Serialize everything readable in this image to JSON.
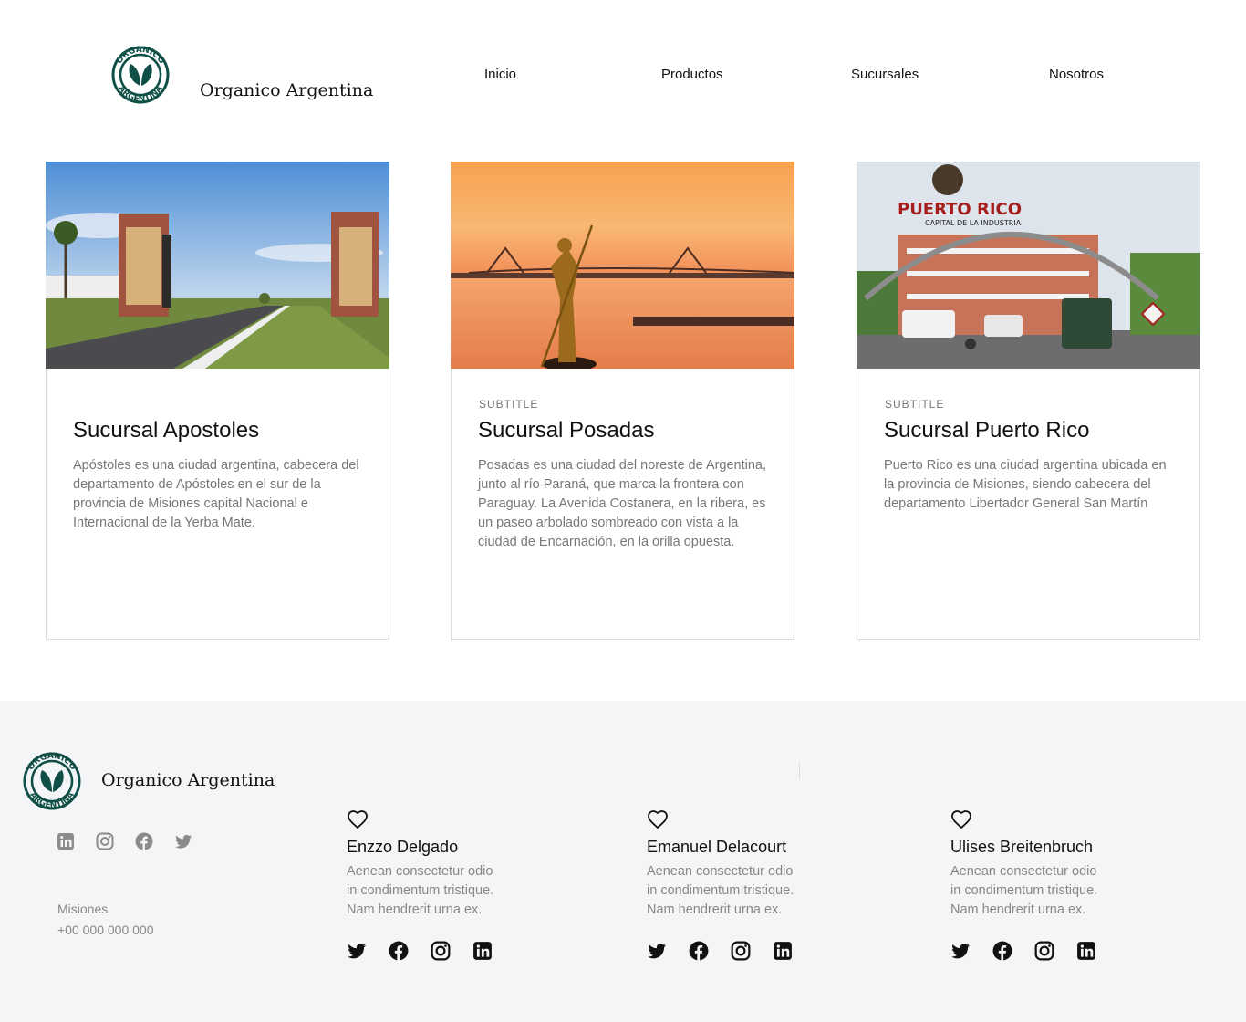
{
  "brand": {
    "name": "Organico Argentina",
    "logo_top_text": "ORGANICO",
    "logo_bottom_text": "ARGENTINA",
    "color": "#0f4f47"
  },
  "nav": {
    "items": [
      "Inicio",
      "Productos",
      "Sucursales",
      "Nosotros"
    ]
  },
  "cards": [
    {
      "subtitle": "",
      "title": "Sucursal Apostoles",
      "text": "Apóstoles es una ciudad argentina, cabecera del departamento de Apóstoles en el sur de la provincia de Misiones capital Nacional e Internacional de la Yerba Mate.",
      "image": "road-with-monuments"
    },
    {
      "subtitle": "SUBTITLE",
      "title": "Sucursal Posadas",
      "text": "Posadas es una ciudad del noreste de Argentina, junto al río Paraná, que marca la frontera con Paraguay. La Avenida Costanera, en la ribera, es un paseo arbolado sombreado con vista a la ciudad de Encarnación, en la orilla opuesta.",
      "image": "sunset-river-statue"
    },
    {
      "subtitle": "SUBTITLE",
      "title": "Sucursal Puerto Rico",
      "text": "Puerto Rico es una ciudad argentina ubicada en la provincia de Misiones, siendo cabecera del departamento Libertador General San Martín",
      "image": "town-arch",
      "arch_text": "PUERTO RICO",
      "arch_subtext": "CAPITAL DE LA INDUSTRIA"
    }
  ],
  "footer": {
    "brand_name": "Organico Argentina",
    "social_icons": [
      "linkedin-icon",
      "instagram-icon",
      "facebook-icon",
      "twitter-icon"
    ],
    "contact": {
      "location": "Misiones",
      "phone": "+00 000 000 000"
    },
    "members": [
      {
        "name": "Enzzo Delgado",
        "text": "Aenean consectetur odio in condimentum tristique. Nam hendrerit urna ex."
      },
      {
        "name": "Emanuel Delacourt",
        "text": "Aenean consectetur odio in condimentum tristique. Nam hendrerit urna ex."
      },
      {
        "name": "Ulises Breitenbruch",
        "text": "Aenean consectetur odio in condimentum tristique. Nam hendrerit urna ex."
      }
    ],
    "member_social_icons": [
      "twitter-icon",
      "facebook-icon",
      "instagram-icon",
      "linkedin-icon"
    ]
  }
}
